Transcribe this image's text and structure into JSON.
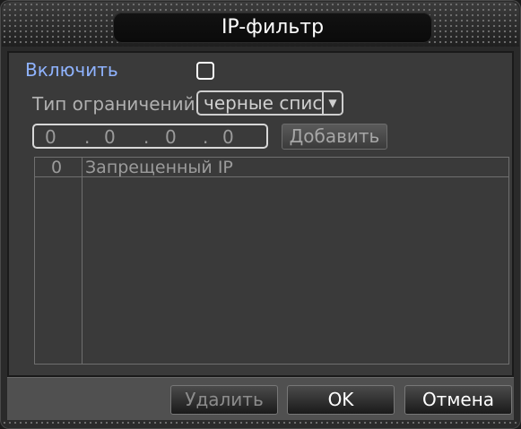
{
  "dialog": {
    "title": "IP-фильтр"
  },
  "form": {
    "enable_label": "Включить",
    "enable_checked": false,
    "restriction_type_label": "Тип ограничений",
    "restriction_type_value": "черные списі",
    "ip_segments": [
      "0",
      "0",
      "0",
      "0"
    ],
    "ip_separator": ".",
    "add_button_label": "Добавить"
  },
  "table": {
    "header_count": "0",
    "header_ip": "Запрещенный IP",
    "rows": []
  },
  "footer": {
    "delete_label": "Удалить",
    "ok_label": "OK",
    "cancel_label": "Отмена"
  },
  "colors": {
    "enable_label": "#8fb3ff",
    "dialog_bg": "#3a3a3a",
    "title_bg": "#0a0a0a"
  },
  "icons": {
    "select_arrow": "chevron-down-icon"
  }
}
